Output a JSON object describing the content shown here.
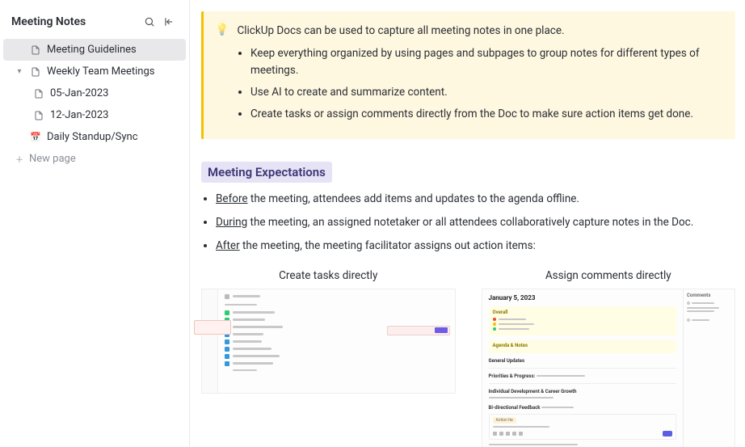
{
  "sidebar": {
    "title": "Meeting Notes",
    "items": [
      {
        "label": "Meeting Guidelines",
        "icon": "doc"
      },
      {
        "label": "Weekly Team Meetings",
        "icon": "doc",
        "expanded": true
      },
      {
        "label": "05-Jan-2023",
        "icon": "doc"
      },
      {
        "label": "12-Jan-2023",
        "icon": "doc"
      },
      {
        "label": "Daily Standup/Sync",
        "icon": "calendar"
      }
    ],
    "new_page_label": "New page"
  },
  "callout": {
    "lead": "ClickUp Docs can be used to capture all meeting notes in one place.",
    "bullets": [
      "Keep everything organized by using pages and subpages to group notes for different types of meetings.",
      "Use AI to create and summarize content.",
      "Create tasks or assign comments directly from the Doc to make sure action items get done."
    ]
  },
  "section": {
    "heading": "Meeting Expectations",
    "items": [
      {
        "u": "Before",
        "rest": " the meeting, attendees add items and updates to the agenda offline."
      },
      {
        "u": "During",
        "rest": " the meeting, an assigned notetaker or all attendees collaboratively capture notes in the Doc."
      },
      {
        "u": "After",
        "rest": " the meeting, the meeting facilitator assigns out action items:"
      }
    ]
  },
  "columns": {
    "left_title": "Create tasks directly",
    "right_title": "Assign comments directly"
  },
  "mock2": {
    "date": "January 5, 2023",
    "overall": "Overall",
    "agenda": "Agenda & Notes",
    "general": "General Updates",
    "priorities": "Priorities & Progress:",
    "individual": "Individual Development & Career Growth",
    "bidir": "Bi-directional Feedback",
    "action": "Action Ite",
    "comments": "Comments"
  }
}
